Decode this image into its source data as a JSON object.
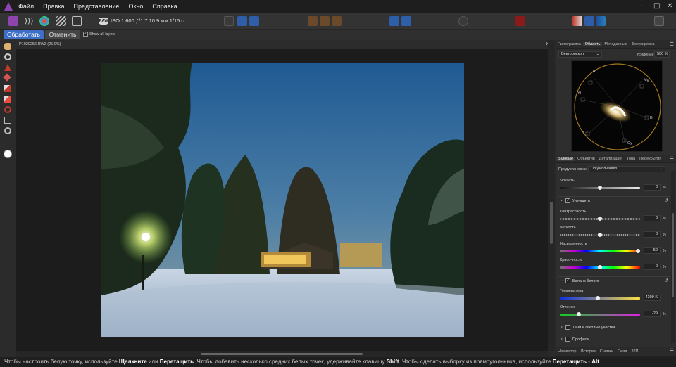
{
  "menu": [
    "Файл",
    "Правка",
    "Представление",
    "Окно",
    "Справка"
  ],
  "window_controls": {
    "minimize": "–",
    "maximize": "□",
    "close": "✕"
  },
  "toolbar": {
    "raw_badge": "RAW",
    "camera_info": "ISO 1,600  ƒ/1.7  10.9 мм  1/15 с"
  },
  "context": {
    "develop_label": "Обработать",
    "cancel_label": "Отменить",
    "show_layers_label": "Show all layers",
    "show_layers_checked": "✓"
  },
  "document": {
    "tab_title": "P1020256.RW2 (25.0%)"
  },
  "top_panel": {
    "tabs": [
      "Гистограмма",
      "Область",
      "Метаданные",
      "Фокусировка"
    ],
    "active_tab": "Область",
    "mode": "Вектороскоп",
    "gain_label": "Усиление:",
    "gain_value": "500 %",
    "scope_labels": [
      "R",
      "Mg",
      "B",
      "Cy",
      "G",
      "Yl"
    ]
  },
  "adjust_panel": {
    "tabs": [
      "Базовые",
      "Объектив",
      "Детализация",
      "Тона",
      "Перекрытия"
    ],
    "active_tab": "Базовые",
    "preset_label": "Предустановка:",
    "preset_value": "По умолчанию",
    "brightness": {
      "label": "Яркость",
      "value": "0",
      "unit": "%"
    },
    "enhance": {
      "title": "Улучшить",
      "checked": "✓",
      "contrast": {
        "label": "Контрастность",
        "value": "0",
        "unit": "%"
      },
      "clarity": {
        "label": "Четкость",
        "value": "0",
        "unit": "%"
      },
      "saturation": {
        "label": "Насыщенность",
        "value": "50",
        "unit": "%"
      },
      "vibrance": {
        "label": "Красочность",
        "value": "0",
        "unit": "%"
      }
    },
    "white_balance": {
      "title": "Баланс белого",
      "checked": "✓",
      "temperature": {
        "label": "Температура",
        "value": "4209 K"
      },
      "tint": {
        "label": "Оттенок",
        "value": "-29",
        "unit": "%"
      }
    },
    "shadows_highlights": {
      "title": "Тени и светлые участки"
    },
    "profiles": {
      "title": "Профили"
    }
  },
  "bottom_panel": {
    "tabs": [
      "Навигатор",
      "История",
      "Снимки",
      "Сеад",
      "32П"
    ]
  },
  "status": {
    "part1": "Чтобы настроить белую точку, используйте ",
    "click": "Щелкните",
    "or": " или ",
    "drag": "Перетащить",
    "part2": ". Чтобы добавить несколько средних белых точек, удерживайте клавишу ",
    "shift": "Shift",
    "part3": ". Чтобы сделать выборку из прямоугольника, используйте ",
    "drag2": "Перетащить",
    "dash": " - ",
    "alt": "Alt",
    "end": "."
  }
}
